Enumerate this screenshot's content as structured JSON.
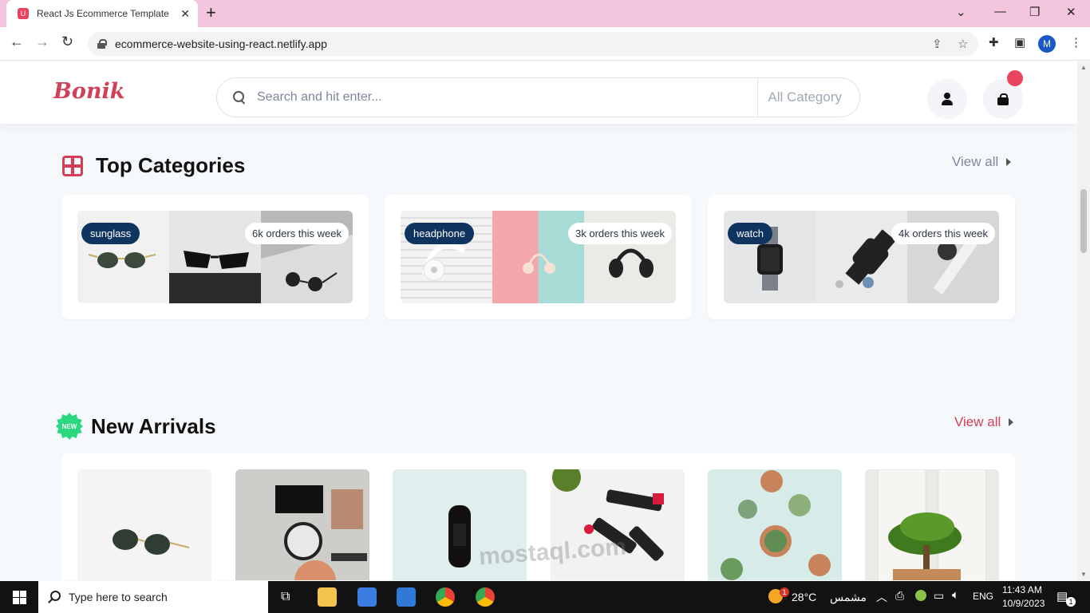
{
  "browser": {
    "tab_title": "React Js Ecommerce Template",
    "tab_favicon": "U",
    "tab_close": "✕",
    "new_tab": "+",
    "url": "ecommerce-website-using-react.netlify.app",
    "profile_initial": "M"
  },
  "header": {
    "logo": "Bonik",
    "search_placeholder": "Search and hit enter...",
    "category_label": "All Category",
    "cart_count_color": "#e94560"
  },
  "top_categories": {
    "title": "Top Categories",
    "view_all": "View all",
    "cards": [
      {
        "label": "sunglass",
        "orders": "6k orders this week"
      },
      {
        "label": "headphone",
        "orders": "3k orders this week"
      },
      {
        "label": "watch",
        "orders": "4k orders this week"
      }
    ]
  },
  "new_arrivals": {
    "badge": "NEW",
    "title": "New Arrivals",
    "view_all": "View all",
    "items": [
      "sunglasses",
      "makeup",
      "fitness-band",
      "lipstick",
      "succulents",
      "bonsai"
    ]
  },
  "taskbar": {
    "search_placeholder": "Type here to search",
    "weather_badge": "1",
    "temperature": "28°C",
    "weather_label": "مشمس",
    "language": "ENG",
    "time": "11:43 AM",
    "date": "10/9/2023",
    "notification_count": "1"
  },
  "watermark": "mostaql.com",
  "colors": {
    "brand": "#d23f57",
    "label_bg": "#0f3460",
    "new_badge": "#2bd87f",
    "tab_strip": "#f3c6de"
  }
}
